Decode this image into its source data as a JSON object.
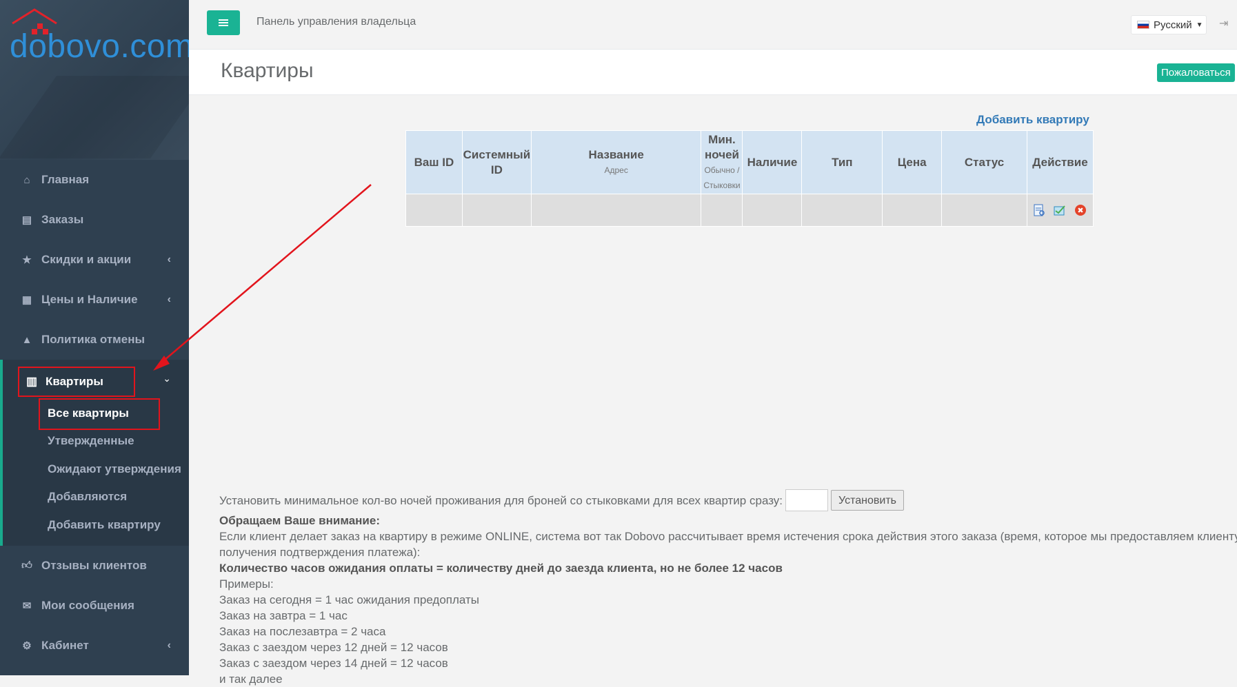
{
  "brand": {
    "logo_text": "dobovo.com"
  },
  "sidebar": {
    "items": [
      {
        "label": "Главная",
        "icon": "home-icon"
      },
      {
        "label": "Заказы",
        "icon": "book-icon"
      },
      {
        "label": "Скидки и акции",
        "icon": "star-icon"
      },
      {
        "label": "Цены и Наличие",
        "icon": "calendar-icon"
      },
      {
        "label": "Политика отмены",
        "icon": "warning-icon"
      }
    ],
    "active_section": {
      "label": "Квартиры",
      "icon": "building-icon"
    },
    "submenu": [
      "Все квартиры",
      "Утвержденные",
      "Ожидают утверждения",
      "Добавляются",
      "Добавить квартиру"
    ],
    "bottom_items": [
      {
        "label": "Отзывы клиентов",
        "icon": "thumbs-up-icon"
      },
      {
        "label": "Мои сообщения",
        "icon": "envelope-icon"
      },
      {
        "label": "Кабинет",
        "icon": "cogs-icon"
      }
    ]
  },
  "header": {
    "panel_title": "Панель управления владельца",
    "language": "Русский"
  },
  "page": {
    "title": "Квартиры",
    "complain_label": "Пожаловаться",
    "add_link": "Добавить квартиру"
  },
  "table": {
    "col_your_id": "Ваш ID",
    "col_system_id": "Системный ID",
    "col_name": "Название",
    "col_name_sub": "Адрес",
    "col_min_nights": "Мин. ночей",
    "col_min_nights_sub": "Обычно / Стыковки",
    "col_availability": "Наличие",
    "col_type": "Тип",
    "col_price": "Цена",
    "col_status": "Статус",
    "col_action": "Действие"
  },
  "footer": {
    "min_nights_label": "Установить минимальное кол-во ночей проживания для броней со стыковками для всех квартир сразу:",
    "set_button": "Установить",
    "attention": "Обращаем Ваше внимание:",
    "para1": "Если клиент делает заказ на квартиру в режиме ONLINE, система вот так Dobovo рассчитывает время истечения срока действия этого заказа (время, которое мы предоставляем клиенту для",
    "para1b": "получения подтверждения платежа):",
    "rule": "Количество часов ожидания оплаты = количеству дней до заезда клиента, но не более 12 часов",
    "examples": "Примеры:",
    "ex1": "Заказ на сегодня = 1 час ожидания предоплаты",
    "ex2": "Заказ на завтра = 1 час",
    "ex3": "Заказ на послезавтра = 2 часа",
    "ex4": "Заказ с заездом через 12 дней = 12 часов",
    "ex5": "Заказ с заездом через 14 дней = 12 часов",
    "ex6": "и так далее"
  }
}
